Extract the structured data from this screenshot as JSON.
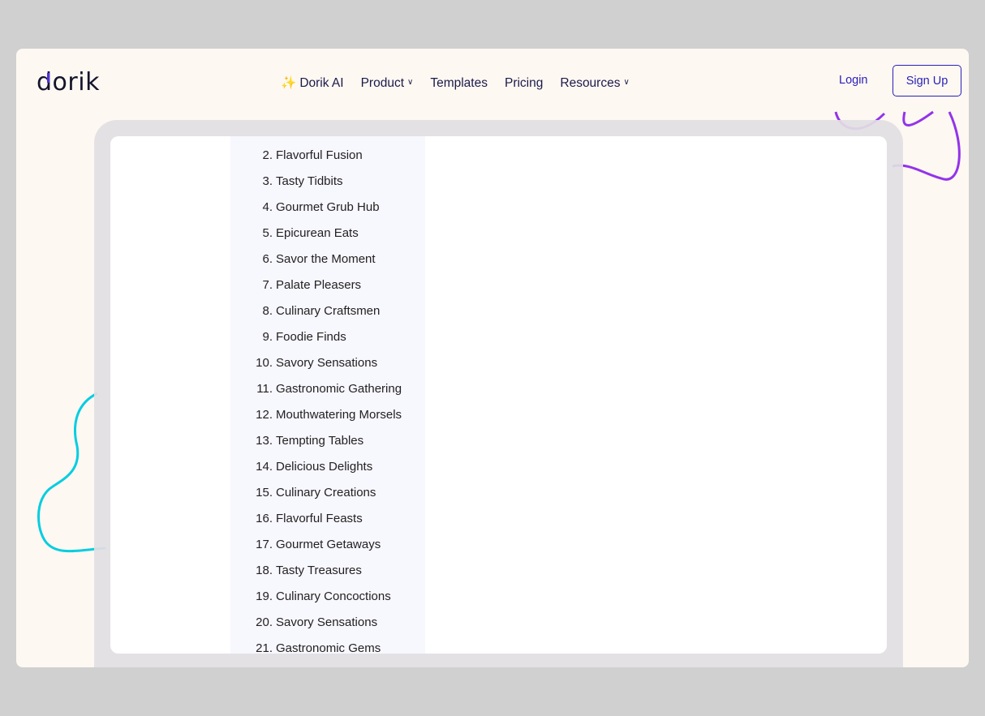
{
  "header": {
    "logo": "dorik",
    "nav": [
      {
        "label": "Dorik AI",
        "icon": "sparkles-icon"
      },
      {
        "label": "Product",
        "dropdown": true
      },
      {
        "label": "Templates"
      },
      {
        "label": "Pricing"
      },
      {
        "label": "Resources",
        "dropdown": true
      }
    ],
    "login": "Login",
    "signup": "Sign Up"
  },
  "colors": {
    "accent": "#2a1fb8",
    "background": "#fdf8f2",
    "purple_swirl": "#9333ea",
    "cyan_swirl": "#06cde0"
  },
  "list": [
    {
      "n": "2.",
      "t": "Flavorful Fusion"
    },
    {
      "n": "3.",
      "t": "Tasty Tidbits"
    },
    {
      "n": "4.",
      "t": "Gourmet Grub Hub"
    },
    {
      "n": "5.",
      "t": "Epicurean Eats"
    },
    {
      "n": "6.",
      "t": "Savor the Moment"
    },
    {
      "n": "7.",
      "t": "Palate Pleasers"
    },
    {
      "n": "8.",
      "t": "Culinary Craftsmen"
    },
    {
      "n": "9.",
      "t": "Foodie Finds"
    },
    {
      "n": "10.",
      "t": "Savory Sensations"
    },
    {
      "n": "11.",
      "t": "Gastronomic Gathering"
    },
    {
      "n": "12.",
      "t": "Mouthwatering Morsels"
    },
    {
      "n": "13.",
      "t": "Tempting Tables"
    },
    {
      "n": "14.",
      "t": "Delicious Delights"
    },
    {
      "n": "15.",
      "t": "Culinary Creations"
    },
    {
      "n": "16.",
      "t": "Flavorful Feasts"
    },
    {
      "n": "17.",
      "t": "Gourmet Getaways"
    },
    {
      "n": "18.",
      "t": "Tasty Treasures"
    },
    {
      "n": "19.",
      "t": "Culinary Concoctions"
    },
    {
      "n": "20.",
      "t": "Savory Sensations"
    },
    {
      "n": "21.",
      "t": "Gastronomic Gems"
    }
  ]
}
